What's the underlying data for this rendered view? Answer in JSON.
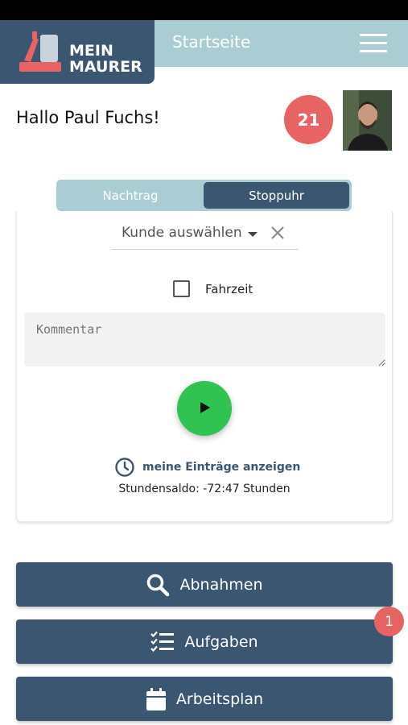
{
  "header": {
    "logo_line1": "MEIN",
    "logo_line2": "MAURER",
    "title": "Startseite",
    "menu_icon": "hamburger-icon"
  },
  "user": {
    "greeting": "Hallo Paul Fuchs!",
    "count": "21"
  },
  "segment": {
    "tab_left": "Nachtrag",
    "tab_right": "Stoppuhr",
    "active": "Stoppuhr"
  },
  "form": {
    "customer_placeholder": "Kunde auswählen",
    "travel_time_label": "Fahrzeit",
    "travel_time_checked": false,
    "comment_placeholder": "Kommentar",
    "entries_link": "meine Einträge anzeigen",
    "hours_balance": "Stundensaldo: -72:47 Stunden"
  },
  "actions": [
    {
      "label": "Abnahmen",
      "icon": "search-icon"
    },
    {
      "label": "Aufgaben",
      "icon": "checklist-icon",
      "badge": "1"
    },
    {
      "label": "Arbeitsplan",
      "icon": "calendar-icon"
    }
  ],
  "colors": {
    "primary": "#3b5671",
    "accent_light": "#a9cdd3",
    "badge_red": "#e86464",
    "play_green": "#31c352"
  }
}
